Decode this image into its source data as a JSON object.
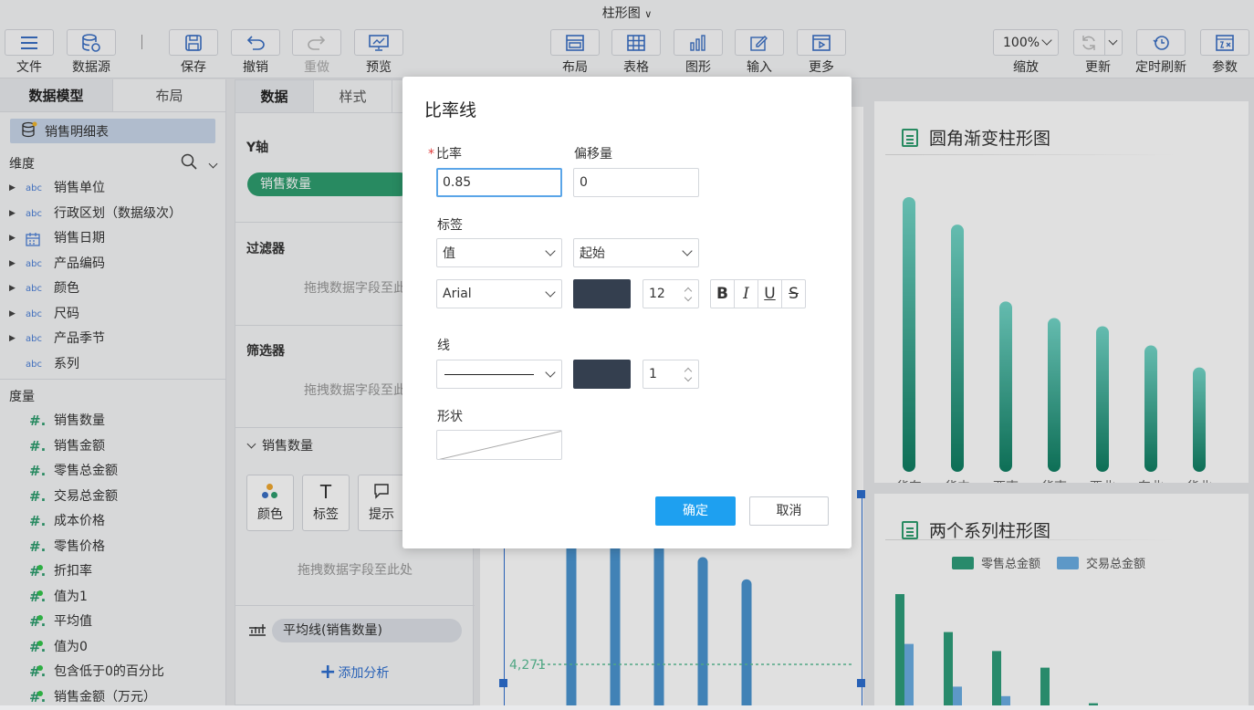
{
  "title": "柱形图",
  "toolbar": {
    "file": "文件",
    "datasource": "数据源",
    "save": "保存",
    "undo": "撤销",
    "redo": "重做",
    "preview": "预览",
    "layout": "布局",
    "table": "表格",
    "chart": "图形",
    "input": "输入",
    "more": "更多",
    "zoom_value": "100%",
    "zoom_label": "缩放",
    "update": "更新",
    "schedule": "定时刷新",
    "params": "参数"
  },
  "left": {
    "tabs": [
      "数据模型",
      "布局"
    ],
    "dataset": "销售明细表",
    "dimension_header": "维度",
    "dimensions": [
      {
        "type": "abc",
        "label": "销售单位"
      },
      {
        "type": "abc",
        "label": "行政区划（数据级次）"
      },
      {
        "type": "date",
        "label": "销售日期"
      },
      {
        "type": "abc",
        "label": "产品编码"
      },
      {
        "type": "abc",
        "label": "颜色"
      },
      {
        "type": "abc",
        "label": "尺码"
      },
      {
        "type": "abc",
        "label": "产品季节"
      },
      {
        "type": "abc",
        "label": "系列"
      }
    ],
    "measure_header": "度量",
    "measures": [
      {
        "label": "销售数量",
        "calc": false
      },
      {
        "label": "销售金额",
        "calc": false
      },
      {
        "label": "零售总金额",
        "calc": false
      },
      {
        "label": "交易总金额",
        "calc": false
      },
      {
        "label": "成本价格",
        "calc": false
      },
      {
        "label": "零售价格",
        "calc": false
      },
      {
        "label": "折扣率",
        "calc": true
      },
      {
        "label": "值为1",
        "calc": true
      },
      {
        "label": "平均值",
        "calc": true
      },
      {
        "label": "值为0",
        "calc": true
      },
      {
        "label": "包含低于0的百分比",
        "calc": true
      },
      {
        "label": "销售金额（万元）",
        "calc": true
      }
    ]
  },
  "middle": {
    "tabs": [
      "数据",
      "样式"
    ],
    "y_axis": "Y轴",
    "y_field": "销售数量",
    "filter": "过滤器",
    "drop_hint": "拖拽数据字段至此处",
    "drop_hint_short": "拖拽数据字段至此",
    "selector": "筛选器",
    "measure_section": "销售数量",
    "buttons": [
      "颜色",
      "标签",
      "提示"
    ],
    "avg_line": "平均线(销售数量)",
    "add_analysis": "添加分析"
  },
  "cards": {
    "card1_title": "圆角渐变柱形图",
    "card2_title": "两个系列柱形图",
    "legend": [
      "零售总金额",
      "交易总金额"
    ],
    "ref_label": "4,271"
  },
  "chart_data": [
    {
      "type": "bar",
      "title": "圆角渐变柱形图",
      "categories": [
        "华东",
        "华中",
        "西南",
        "华南",
        "西北",
        "东北",
        "华北"
      ],
      "values": [
        100,
        90,
        62,
        56,
        53,
        46,
        38
      ],
      "colors": [
        "#73d6c8",
        "#107e62"
      ]
    },
    {
      "type": "bar",
      "title": "两个系列柱形图",
      "categories": [
        "",
        "",
        "",
        "",
        "",
        "",
        ""
      ],
      "series": [
        {
          "name": "零售总金额",
          "values": [
            100,
            68,
            52,
            38,
            8,
            3,
            1
          ],
          "color": "#2e9e7a"
        },
        {
          "name": "交易总金额",
          "values": [
            58,
            22,
            14,
            4,
            2,
            1,
            0
          ],
          "color": "#6aaee3"
        }
      ]
    },
    {
      "type": "bar",
      "categories": [
        "",
        "",
        "",
        "",
        ""
      ],
      "values": [
        150,
        122,
        38,
        26,
        13
      ],
      "reference_line": {
        "label": "4,271"
      },
      "color": "#4a94d0"
    }
  ],
  "dialog": {
    "title": "比率线",
    "ratio_label": "比率",
    "ratio_value": "0.85",
    "offset_label": "偏移量",
    "offset_value": "0",
    "label_section": "标签",
    "label_content": "值",
    "label_position": "起始",
    "font": "Arial",
    "font_color": "#343f4f",
    "font_size": "12",
    "line_section": "线",
    "line_color": "#343f4f",
    "line_width": "1",
    "shape_section": "形状",
    "ok": "确定",
    "cancel": "取消"
  }
}
